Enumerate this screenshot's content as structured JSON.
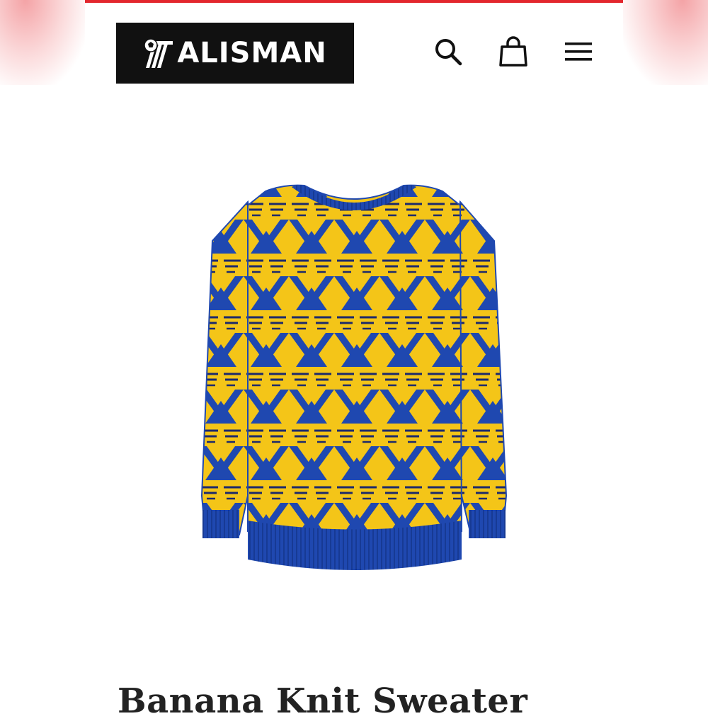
{
  "brand": {
    "logo_text": "ALISMAN",
    "logo_mark": "ball-icon",
    "accent_color": "#e3262d"
  },
  "header": {
    "icons": [
      "search-icon",
      "cart-icon",
      "menu-icon"
    ]
  },
  "product": {
    "title": "Banana Knit Sweater",
    "colors": {
      "primary": "#f4c518",
      "secondary": "#1f48b0"
    }
  }
}
